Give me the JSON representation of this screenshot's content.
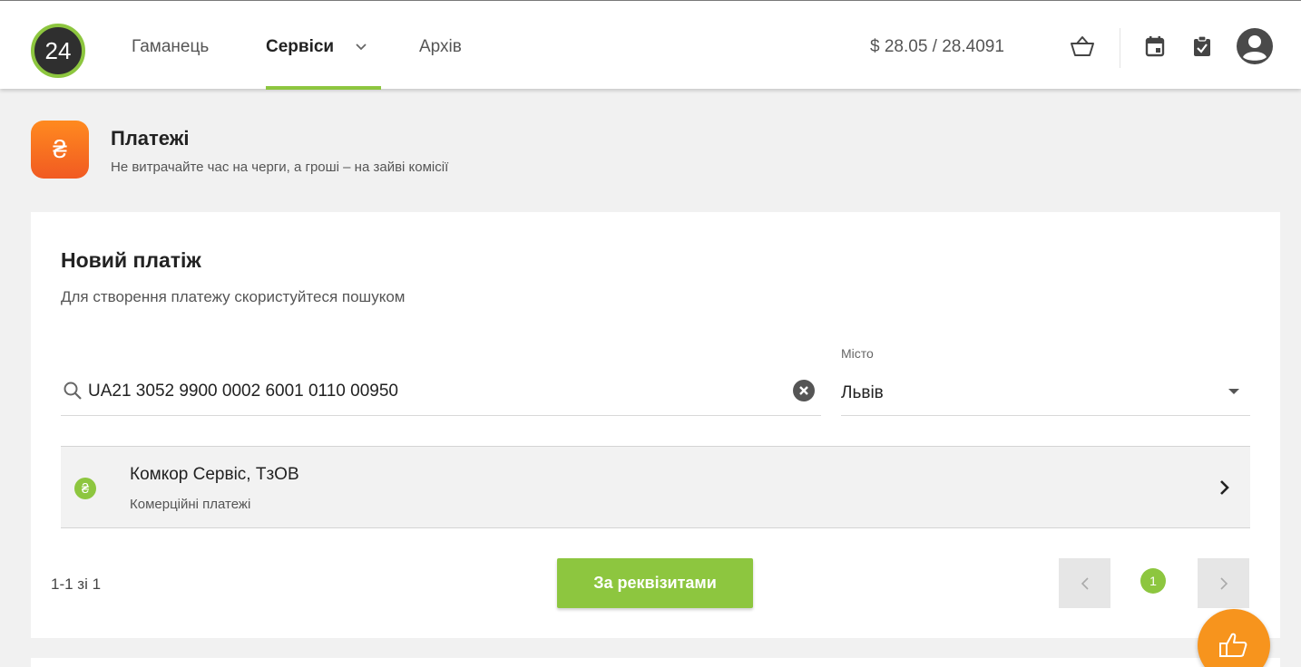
{
  "header": {
    "logo_text": "24",
    "nav": {
      "wallet": "Гаманець",
      "services": "Сервіси",
      "archive": "Архів"
    },
    "exchange_rate": "$ 28.05 / 28.4091",
    "icons": [
      "basket-icon",
      "calendar-icon",
      "clipboard-check-icon",
      "user-avatar-icon"
    ]
  },
  "service": {
    "icon_glyph": "₴",
    "title": "Платежі",
    "subtitle": "Не витрачайте час на черги, а гроші – на зайві комісії"
  },
  "payment": {
    "title": "Новий платіж",
    "subtitle": "Для створення платежу скористуйтеся пошуком",
    "search_value": "UA21 3052 9900 0002 6001 0110 00950",
    "city_label": "Місто",
    "city_value": "Львів",
    "result": {
      "icon_glyph": "₴",
      "name": "Комкор Сервіс, ТзОВ",
      "category": "Комерційні платежі"
    },
    "pagination_info": "1-1 зі 1",
    "requisites_button": "За реквізитами",
    "current_page": "1"
  },
  "colors": {
    "accent_green": "#8dc63f",
    "accent_orange": "#f7941d"
  }
}
